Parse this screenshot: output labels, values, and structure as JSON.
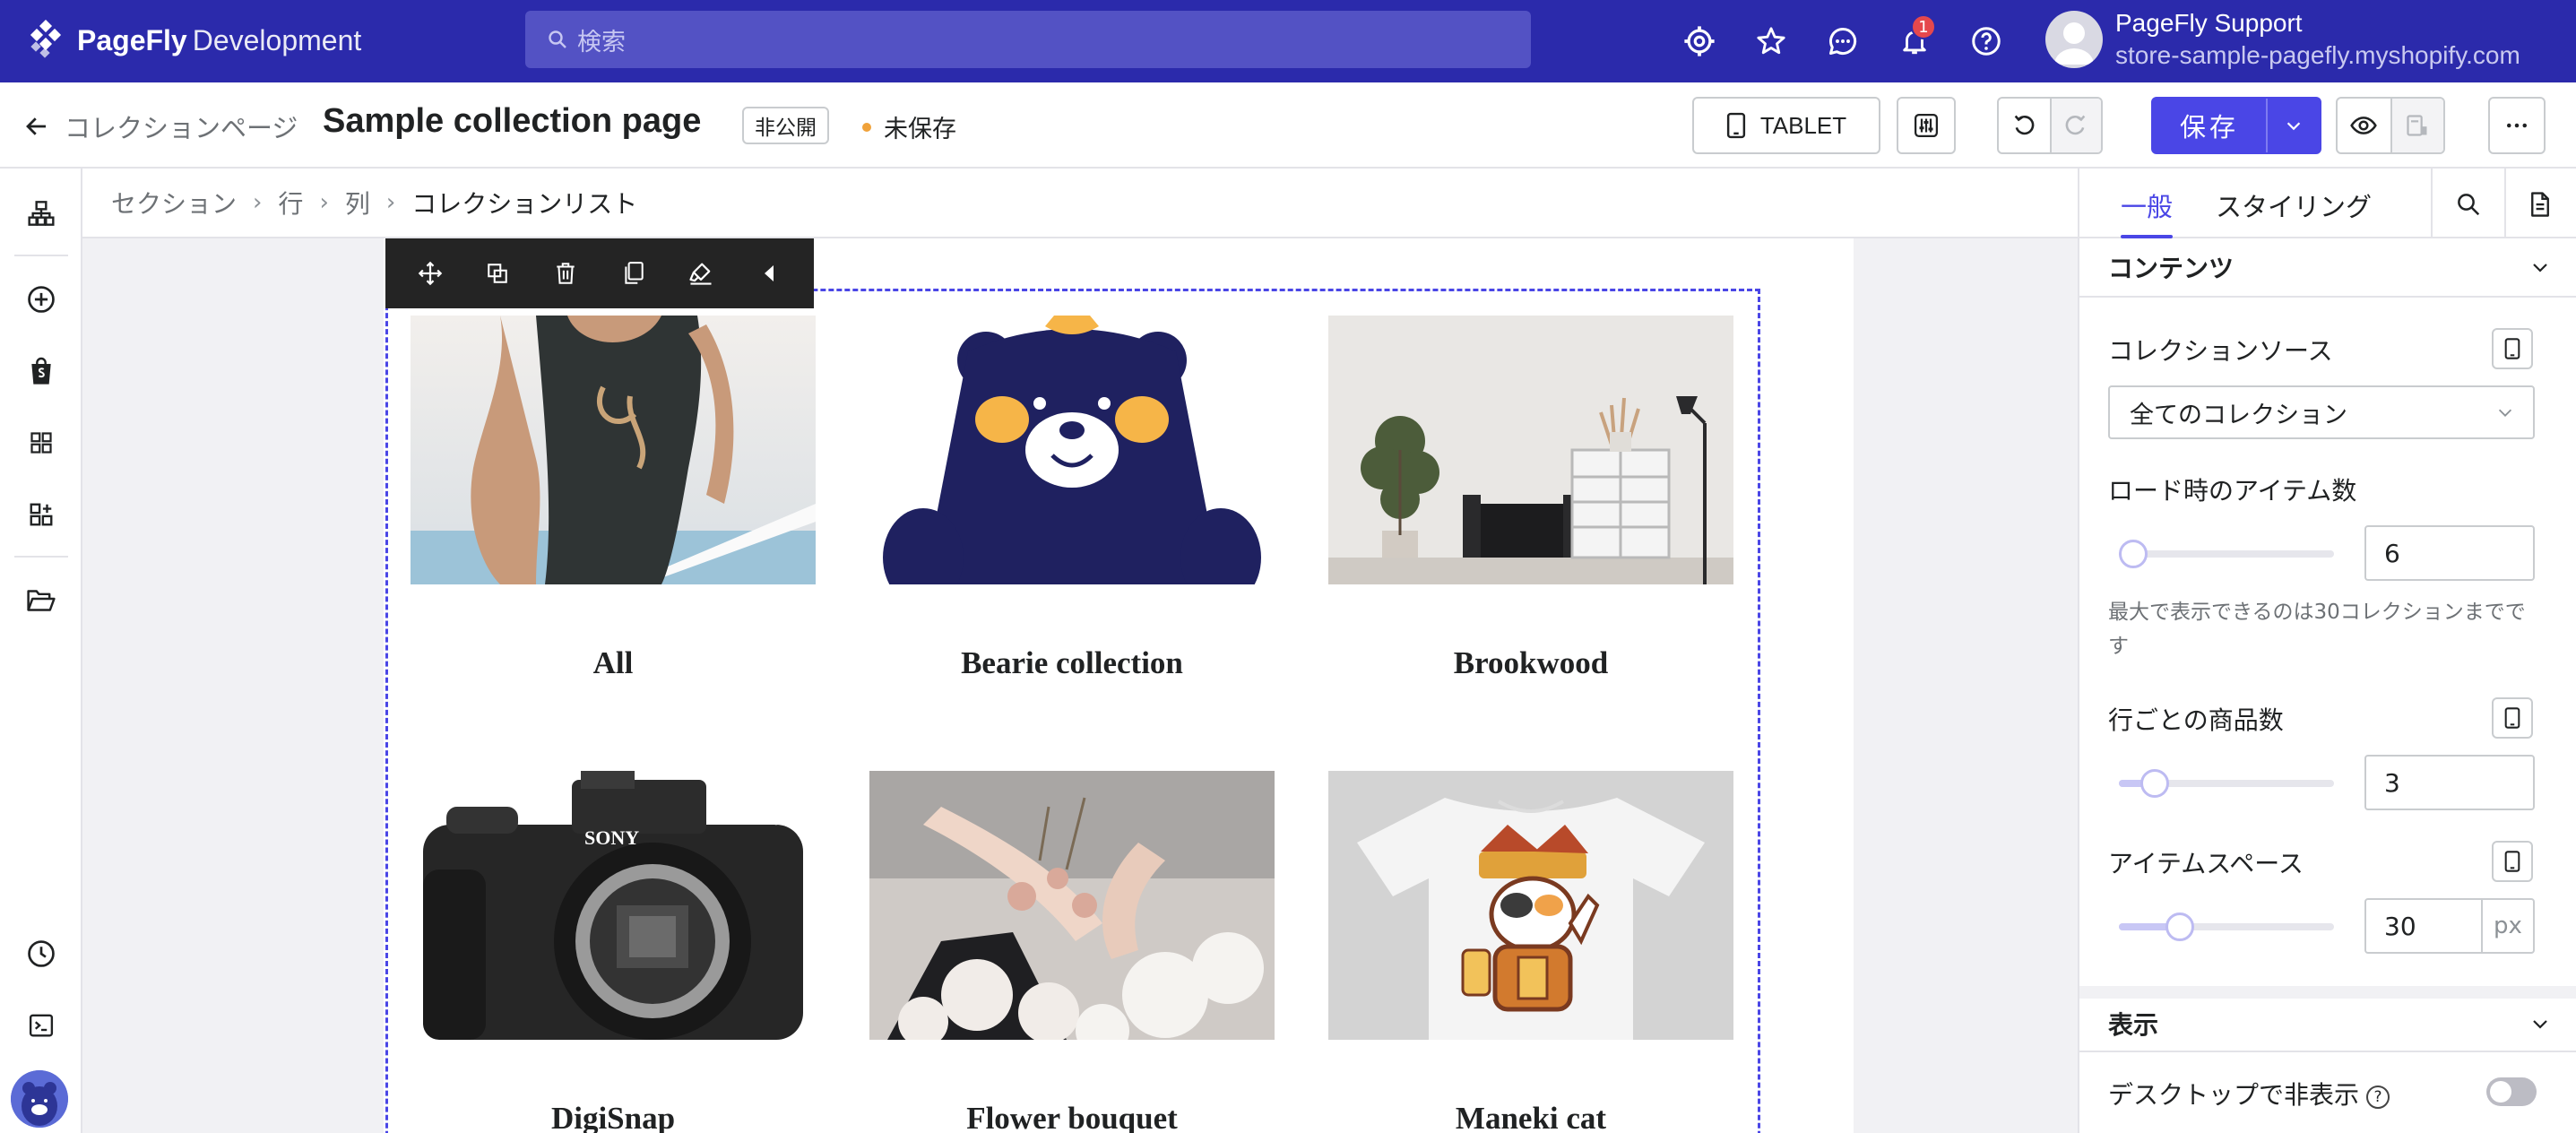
{
  "app": {
    "logo_text": "PageFly",
    "logo_sub": "Development",
    "search_placeholder": "検索",
    "notification_count": "1",
    "user_name": "PageFly Support",
    "user_store": "store-sample-pagefly.myshopify.com"
  },
  "pagebar": {
    "back_label": "コレクションページ",
    "title": "Sample collection page",
    "visibility_tag": "非公開",
    "save_state": "未保存",
    "device_label": "TABLET",
    "save_label": "保存"
  },
  "breadcrumb": [
    "セクション",
    "行",
    "列",
    "コレクションリスト"
  ],
  "collections": [
    {
      "title": "All"
    },
    {
      "title": "Bearie collection"
    },
    {
      "title": "Brookwood"
    },
    {
      "title": "DigiSnap"
    },
    {
      "title": "Flower bouquet"
    },
    {
      "title": "Maneki cat"
    }
  ],
  "panel": {
    "tab_general": "一般",
    "tab_styling": "スタイリング",
    "section_content": "コンテンツ",
    "collection_source_label": "コレクションソース",
    "collection_source_value": "全てのコレクション",
    "items_on_load_label": "ロード時のアイテム数",
    "items_on_load_value": "6",
    "items_on_load_hint": "最大で表示できるのは30コレクションまでです",
    "per_row_label": "行ごとの商品数",
    "per_row_value": "3",
    "item_space_label": "アイテムスペース",
    "item_space_value": "30",
    "item_space_unit": "px",
    "section_display": "表示",
    "hide_desktop_label": "デスクトップで非表示",
    "hide_desktop_help": "?"
  },
  "colors": {
    "topbar": "#2b2aab",
    "accent": "#4a46e6",
    "unsaved_dot": "#f0a23a",
    "bear_navy": "#1f2160"
  }
}
